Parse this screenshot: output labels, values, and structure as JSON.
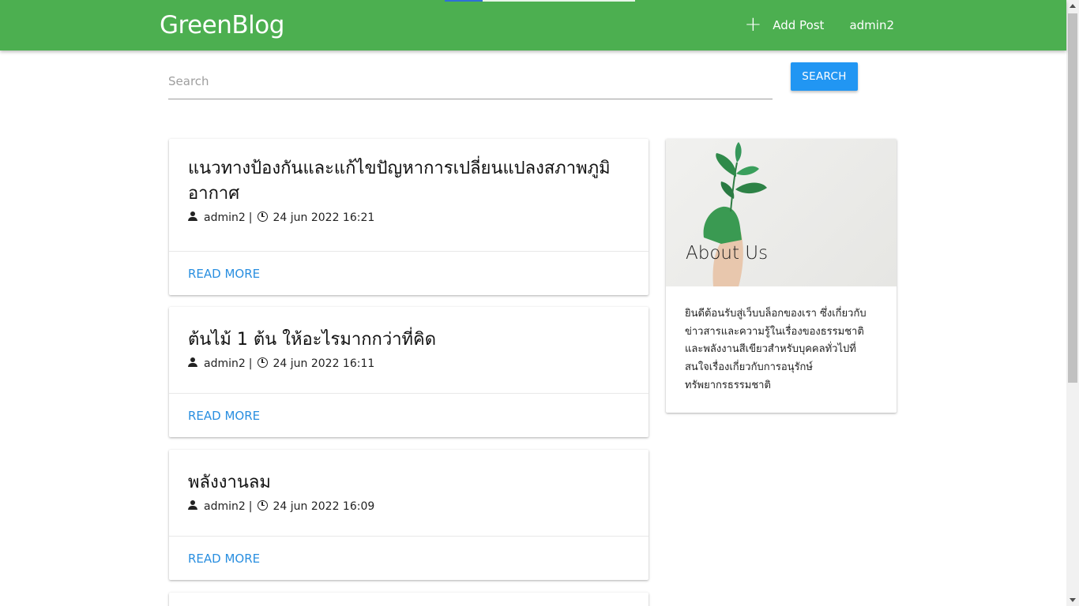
{
  "navbar": {
    "brand": "GreenBlog",
    "add_post_label": "Add Post",
    "plus_glyph": "+",
    "user_label": "admin2",
    "color": "#4caf50"
  },
  "search": {
    "placeholder": "Search",
    "value": "",
    "button_label": "SEARCH",
    "button_color": "#2196f3"
  },
  "posts": [
    {
      "title": "แนวทางป้องกันและแก้ไขปัญหาการเปลี่ยนแปลงสภาพภูมิอากาศ",
      "author": "admin2",
      "separator": "|",
      "date": "24 jun 2022 16:21",
      "action": "READ MORE"
    },
    {
      "title": "ต้นไม้ 1 ต้น ให้อะไรมากกว่าที่คิด",
      "author": "admin2",
      "separator": "|",
      "date": "24 jun 2022 16:11",
      "action": "READ MORE"
    },
    {
      "title": "พลังงานลม",
      "author": "admin2",
      "separator": "|",
      "date": "24 jun 2022 16:09",
      "action": "READ MORE"
    }
  ],
  "about": {
    "title": "About Us",
    "text": "ยินดีต้อนรับสู่เว็บบล็อกของเรา ซึ่งเกี่ยวกับข่าวสารและความรู้ในเรื่องของธรรมชาติและพลังงานสีเขียวสำหรับบุคคลทั่วไปที่สนใจเรื่องเกี่ยวกับการอนุรักษ์ทรัพยากรธรรมชาติ",
    "image_subject": "hand-holding-plant-image"
  },
  "link_color": "#2a8fe0"
}
